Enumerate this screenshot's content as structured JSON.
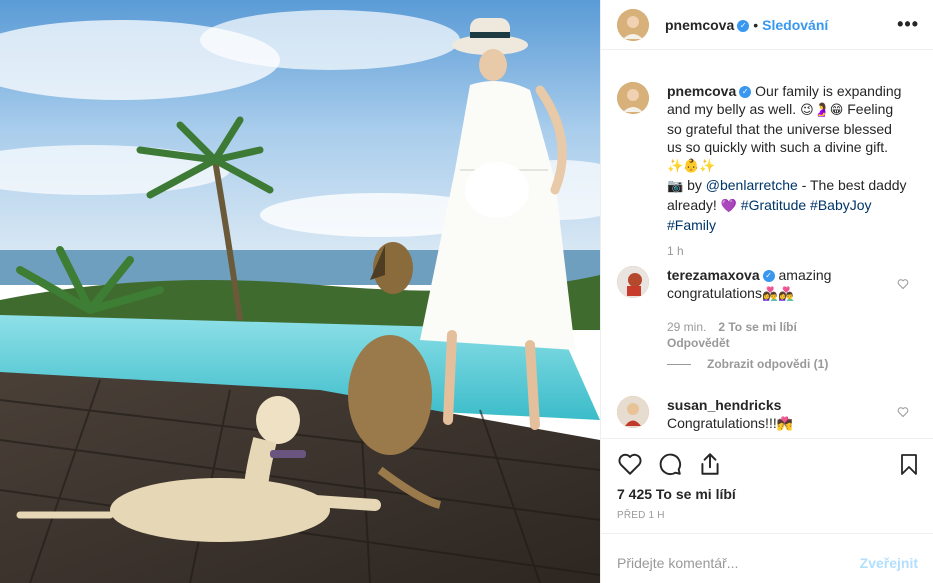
{
  "post": {
    "username": "pnemcova",
    "follow_label": "Sledování",
    "separator": "•",
    "more_label": "•••"
  },
  "caption": {
    "username": "pnemcova",
    "text_1": "Our family is expanding and my belly as well.",
    "emoji_1": "😉🤰😁",
    "text_2": "Feeling so grateful that the universe blessed us so quickly with such a divine gift.",
    "emoji_2": "✨👶✨",
    "camera": "📷",
    "by": "by",
    "photo_credit": "@benlarretche",
    "text_3": "- The best daddy already!",
    "heart": "💜",
    "tag_1": "#Gratitude",
    "tag_2": "#BabyJoy",
    "tag_3": "#Family",
    "age": "1 h"
  },
  "comments": [
    {
      "username": "terezamaxova",
      "text": "amazing congratulations",
      "emoji": "👩‍❤️‍👨👩‍❤️‍👨",
      "age": "29 min.",
      "likes": "2 To se mi líbí",
      "reply": "Odpovědět",
      "view_replies": "Zobrazit odpovědi (1)"
    },
    {
      "username": "susan_hendricks",
      "text": "Congratulations!!!",
      "emoji": "💏"
    }
  ],
  "likes_count": "7 425 To se mi líbí",
  "posted_ago": "PŘED 1 H",
  "add_comment": {
    "placeholder": "Přidejte komentář...",
    "post_label": "Zveřejnit"
  },
  "colors": {
    "accent": "#3897f0",
    "link": "#003569",
    "muted": "#999999",
    "post_disabled": "#b2dffc",
    "border": "#efefef"
  },
  "icons": [
    "heart-icon",
    "comment-icon",
    "share-icon",
    "bookmark-icon",
    "verified-icon",
    "more-icon"
  ]
}
